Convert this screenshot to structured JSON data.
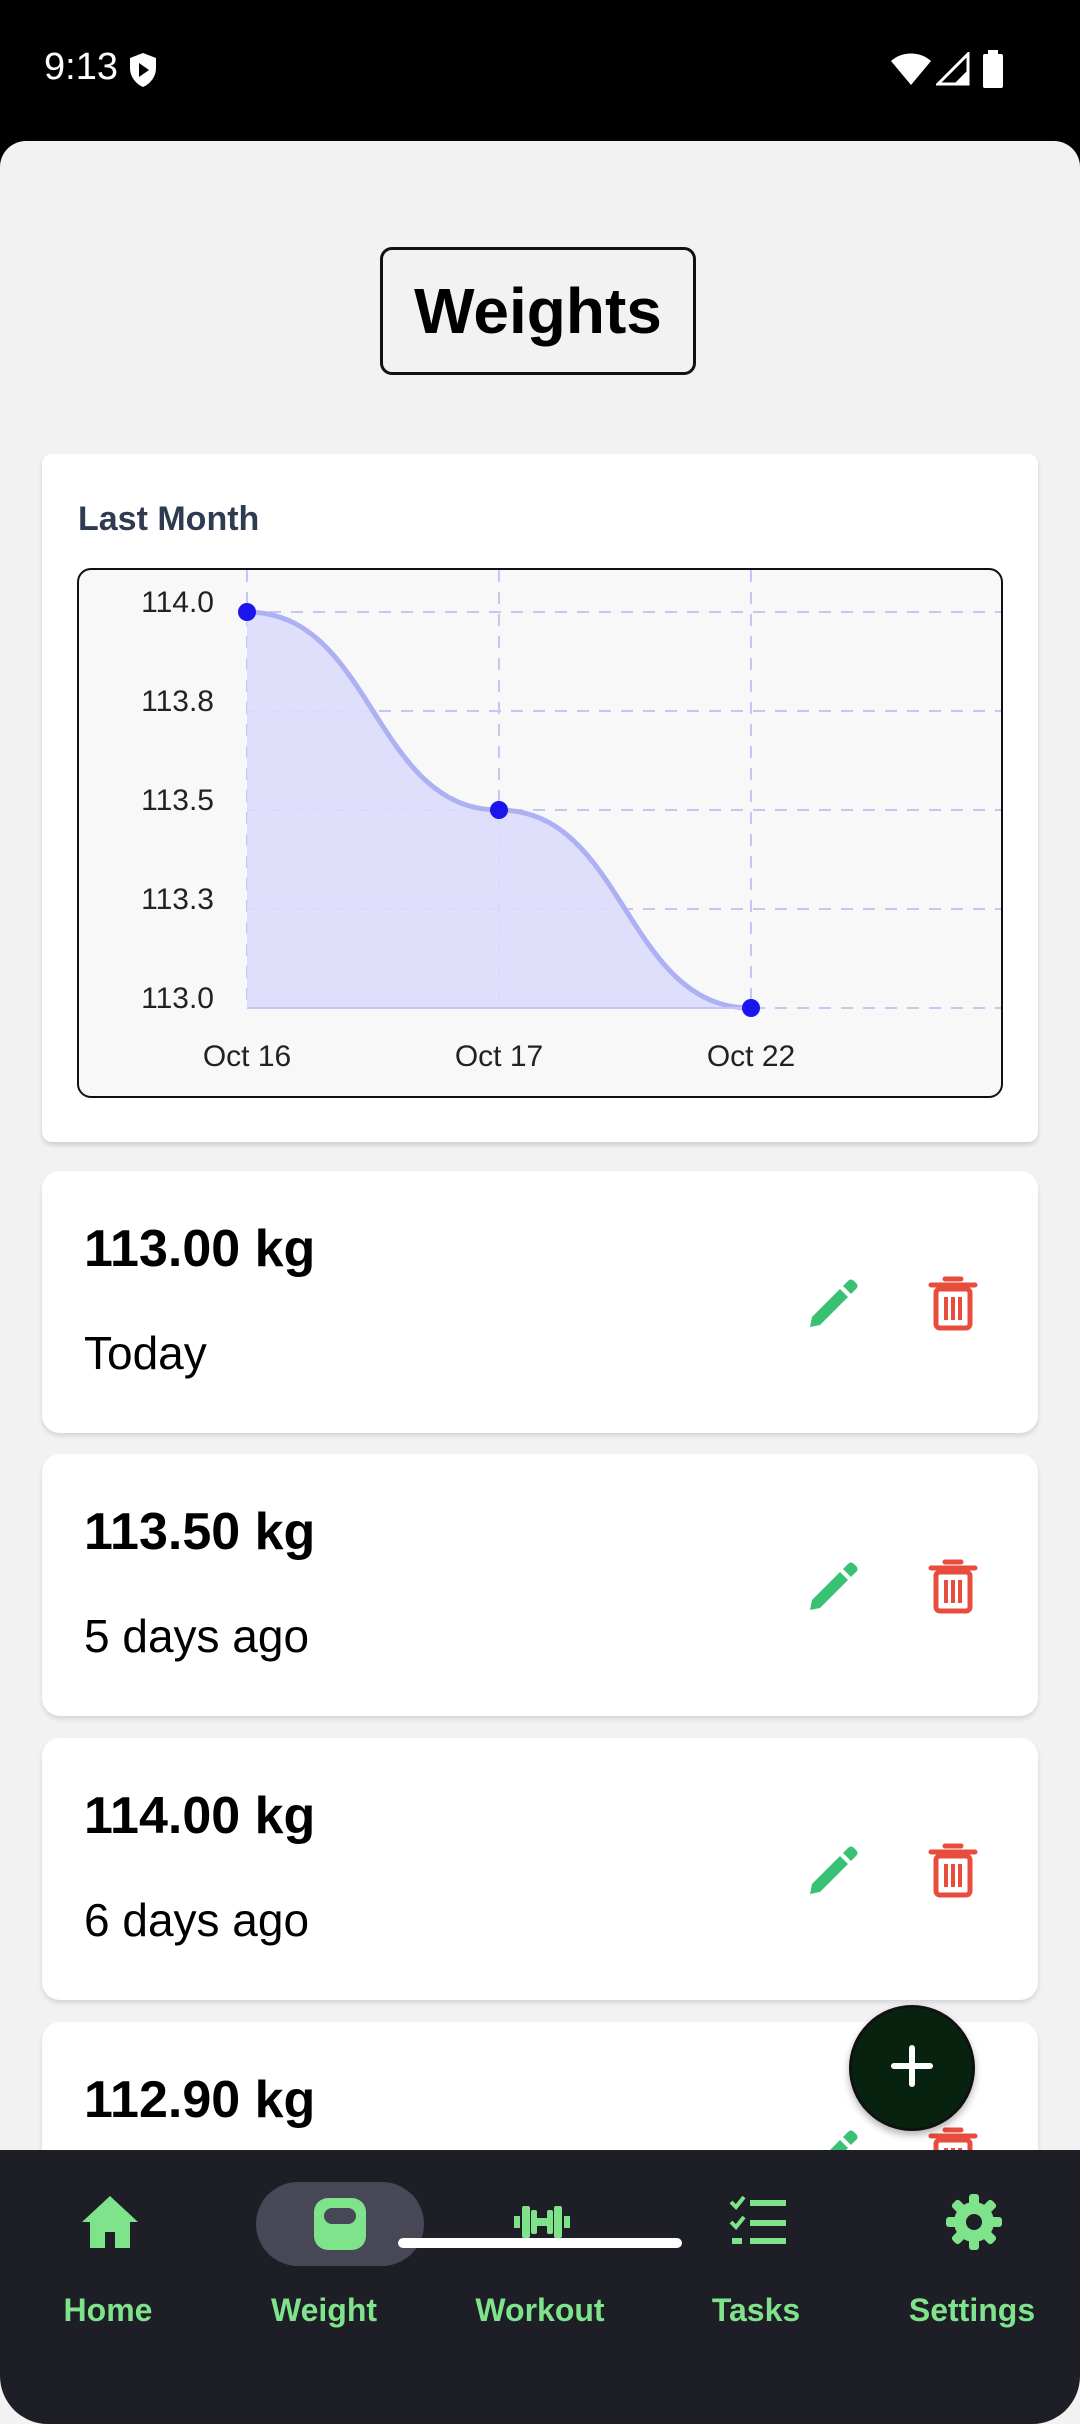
{
  "status_bar": {
    "time": "9:13"
  },
  "page": {
    "title": "Weights"
  },
  "chart_card": {
    "title": "Last Month"
  },
  "chart_data": {
    "type": "area",
    "title": "Last Month",
    "x": [
      "Oct 16",
      "Oct 17",
      "Oct 22"
    ],
    "y": [
      114.0,
      113.5,
      113.0
    ],
    "y_ticks": [
      "114.0",
      "113.8",
      "113.5",
      "113.3",
      "113.0"
    ],
    "ylim": [
      113.0,
      114.0
    ],
    "grid": true,
    "colors": {
      "line": "#aeb0f4",
      "fill": "#dcdcfb",
      "point": "#1a14ee",
      "grid": "#c7c6f2"
    }
  },
  "entries": [
    {
      "weight": "113.00 kg",
      "date": "Today"
    },
    {
      "weight": "113.50 kg",
      "date": "5 days ago"
    },
    {
      "weight": "114.00 kg",
      "date": "6 days ago"
    },
    {
      "weight": "112.90 kg",
      "date": ""
    }
  ],
  "fab": {
    "icon": "plus-icon"
  },
  "nav": {
    "items": [
      {
        "label": "Home",
        "icon": "home-icon"
      },
      {
        "label": "Weight",
        "icon": "kettlebell-icon",
        "active": true
      },
      {
        "label": "Workout",
        "icon": "dumbbell-icon"
      },
      {
        "label": "Tasks",
        "icon": "checklist-icon"
      },
      {
        "label": "Settings",
        "icon": "gear-icon"
      }
    ]
  },
  "colors": {
    "accent": "#7fe38c",
    "edit": "#38c172",
    "delete": "#e74c3c",
    "nav_bg": "#1e1e26",
    "fab_bg": "#07220f"
  }
}
